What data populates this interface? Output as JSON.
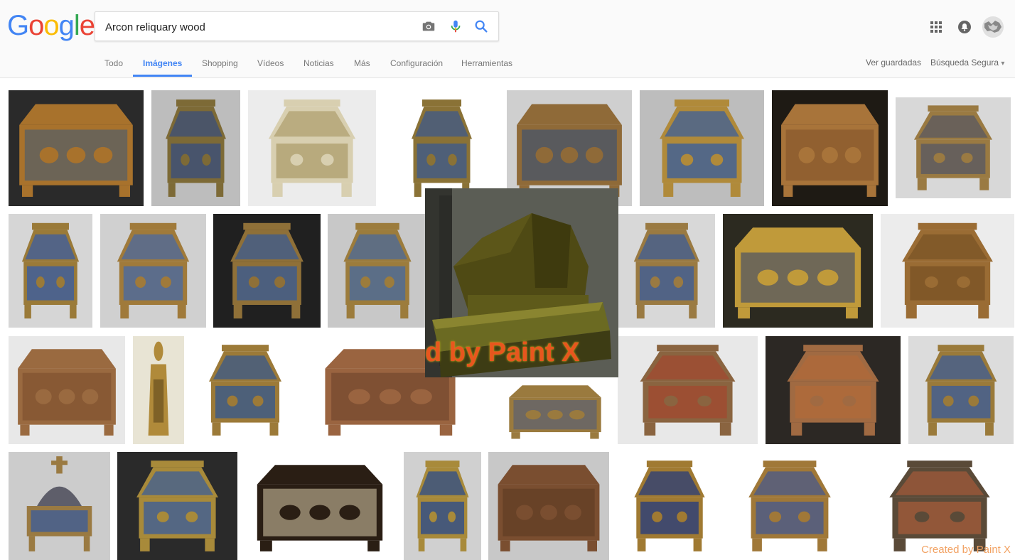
{
  "logo": {
    "text": "Google",
    "letters": [
      "G",
      "o",
      "o",
      "g",
      "l",
      "e"
    ],
    "colors": [
      "#4285f4",
      "#ea4335",
      "#fbbc05",
      "#4285f4",
      "#34a853",
      "#ea4335"
    ]
  },
  "search": {
    "query": "Arcon reliquary wood",
    "camera_icon": "camera-icon",
    "mic_icon": "microphone-icon",
    "search_icon": "search-icon"
  },
  "tabs": [
    "Todo",
    "Imágenes",
    "Shopping",
    "Vídeos",
    "Noticias",
    "Más",
    "Configuración",
    "Herramientas"
  ],
  "active_tab": "Imágenes",
  "right_links": {
    "saved": "Ver guardadas",
    "safe_search": "Búsqueda Segura",
    "safe_search_arrow": "▾"
  },
  "header_icons": [
    "apps-grid-icon",
    "notifications-icon",
    "account-avatar"
  ],
  "overlay": {
    "watermark": "d by Paint X"
  },
  "corner_watermark": "Created by Paint X",
  "accent_color": "#4285f4"
}
